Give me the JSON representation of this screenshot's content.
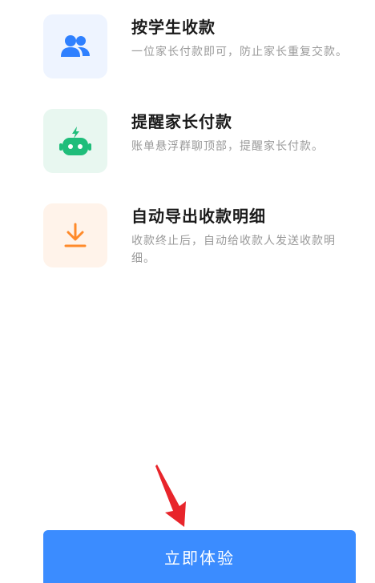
{
  "features": [
    {
      "title": "按学生收款",
      "desc": "一位家长付款即可，防止家长重复交款。",
      "icon": "users-icon",
      "bg": "#eef4ff",
      "color": "#2f80ff"
    },
    {
      "title": "提醒家长付款",
      "desc": "账单悬浮群聊顶部，提醒家长付款。",
      "icon": "robot-icon",
      "bg": "#e8f7f0",
      "color": "#1fbd7a"
    },
    {
      "title": "自动导出收款明细",
      "desc": "收款终止后，自动给收款人发送收款明细。",
      "icon": "download-icon",
      "bg": "#fff3ea",
      "color": "#ff8a2a"
    }
  ],
  "cta": {
    "label": "立即体验",
    "color": "#3b8cff"
  },
  "annotation": {
    "color": "#e8252b"
  }
}
